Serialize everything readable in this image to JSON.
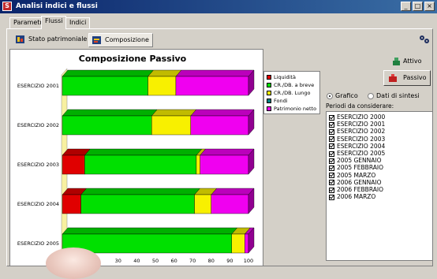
{
  "window": {
    "title": "Analisi indici e flussi"
  },
  "tabs": [
    {
      "label": "Parametri"
    },
    {
      "label": "Flussi"
    },
    {
      "label": "Indici"
    }
  ],
  "subtabs": [
    {
      "label": "Stato patrimoniale"
    },
    {
      "label": "Composizione"
    }
  ],
  "buttons": {
    "attivo": "Attivo",
    "passivo": "Passivo"
  },
  "radio": {
    "grafico": "Grafico",
    "dati": "Dati di sintesi"
  },
  "periods": {
    "label": "Periodi da considerare:",
    "items": [
      "ESERCIZIO 2000",
      "ESERCIZIO 2001",
      "ESERCIZIO 2002",
      "ESERCIZIO 2003",
      "ESERCIZIO 2004",
      "ESERCIZIO 2005",
      "2005 GENNAIO",
      "2005 FEBBRAIO",
      "2005 MARZO",
      "2006 GENNAIO",
      "2006 FEBBRAIO",
      "2006 MARZO"
    ]
  },
  "chart_data": {
    "type": "bar",
    "orientation": "horizontal",
    "stacked": true,
    "title": "Composizione Passivo",
    "categories": [
      "ESERCIZIO 2001",
      "ESERCIZIO 2002",
      "ESERCIZIO 2003",
      "ESERCIZIO 2004",
      "ESERCIZIO 2005"
    ],
    "series": [
      {
        "name": "Liquidità",
        "color": "#e00000",
        "values": [
          0,
          0,
          12,
          10,
          0
        ]
      },
      {
        "name": "CR./DB. a breve",
        "color": "#00e000",
        "values": [
          46,
          48,
          60,
          61,
          91
        ]
      },
      {
        "name": "CR./DB. Lungo",
        "color": "#f8f000",
        "values": [
          15,
          21,
          2,
          9,
          7
        ]
      },
      {
        "name": "Fondi",
        "color": "#008080",
        "values": [
          0,
          0,
          0,
          0,
          0
        ]
      },
      {
        "name": "Patrimonio netto",
        "color": "#f000f0",
        "values": [
          39,
          31,
          26,
          20,
          2
        ]
      }
    ],
    "xlim": [
      0,
      100
    ],
    "xticks": [
      "30",
      "40",
      "50",
      "60",
      "70",
      "80",
      "90",
      "100"
    ]
  },
  "colors": {
    "titlebar": "#0a246a",
    "face": "#d4d0c8"
  }
}
